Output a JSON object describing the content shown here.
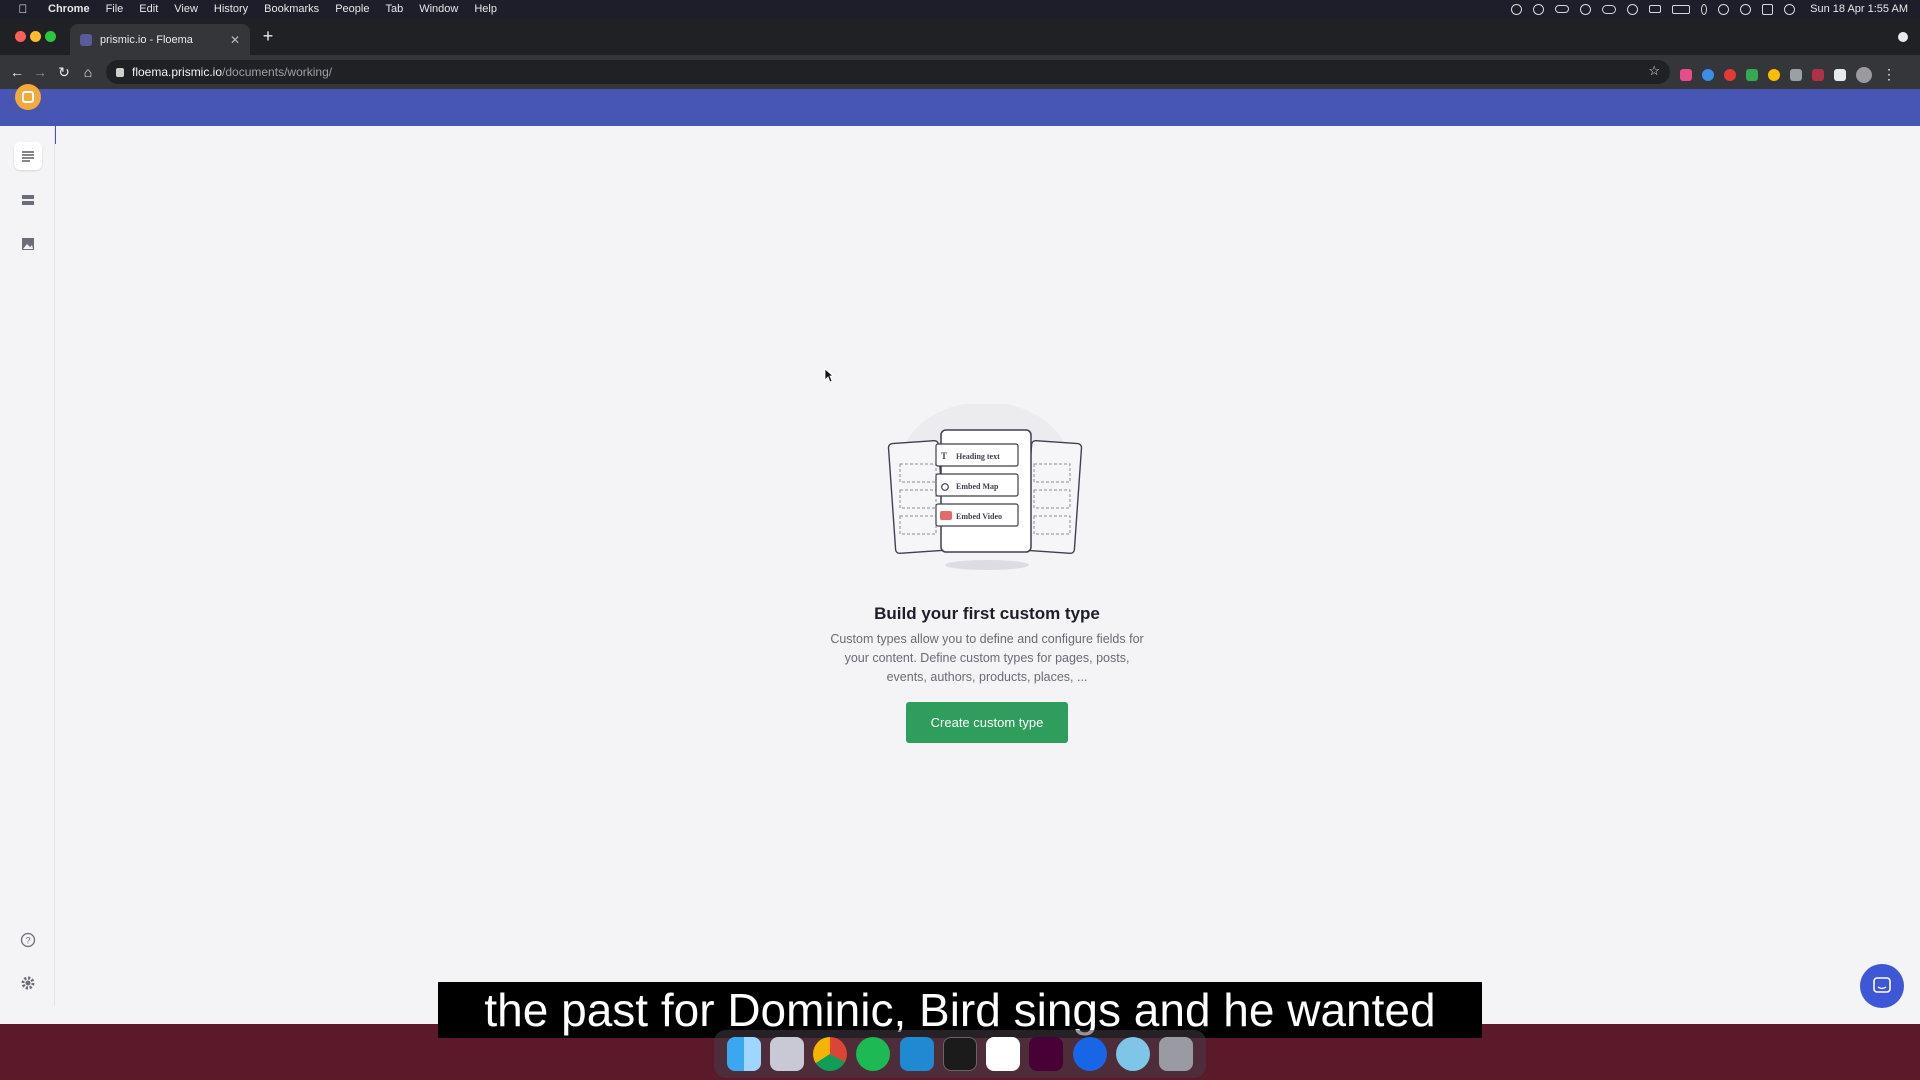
{
  "menubar": {
    "app": "Chrome",
    "menus": [
      "File",
      "Edit",
      "View",
      "History",
      "Bookmarks",
      "People",
      "Tab",
      "Window",
      "Help"
    ],
    "clock": "Sun 18 Apr  1:55 AM"
  },
  "browser": {
    "tab_title": "prismic.io - Floema",
    "url_host": "floema.prismic.io",
    "url_path": "/documents/working/"
  },
  "app": {
    "brand_color": "#4756b3",
    "logo_color": "#f3a93b",
    "sidebar": [
      "documents-icon",
      "custom-types-icon",
      "media-icon",
      "help-icon",
      "settings-icon"
    ]
  },
  "illustration": {
    "card_1": "Heading text",
    "card_2": "Embed Map",
    "card_3": "Embed Video"
  },
  "empty_state": {
    "title": "Build your first custom type",
    "description": "Custom types allow you to define and configure fields for your content. Define custom types for pages, posts, events, authors, products, places, ...",
    "button": "Create custom type",
    "button_color": "#2f9e5c"
  },
  "caption": "the past for Dominic, Bird sings and he wanted",
  "dock": [
    "finder",
    "launchpad",
    "chrome",
    "spotify",
    "vscode",
    "terminal",
    "slack",
    "adobe-xd",
    "maps-pin",
    "network-utility",
    "trash"
  ]
}
